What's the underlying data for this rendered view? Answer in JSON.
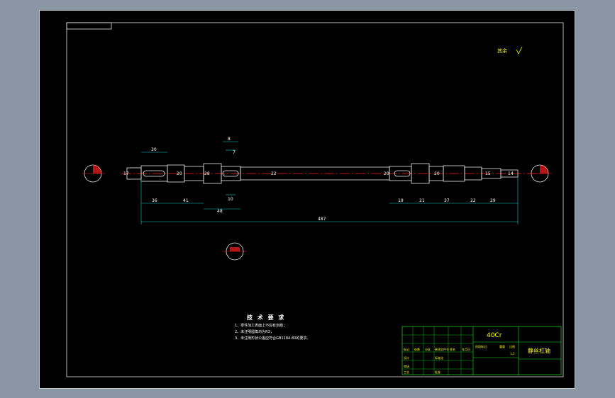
{
  "material": "40Cr",
  "part_name": "静丝杠轴",
  "tech_title": "技 术 要 求",
  "tech_notes": [
    "1、零件加工表面上不应有划痕；",
    "2、未注明圆角均为R3；",
    "3、未注明形状公差应符合GB1184-80的要求。"
  ],
  "roughness_note": "其余",
  "overall_length": "487",
  "dims_top": [
    "30",
    "8",
    "7"
  ],
  "dims_bottom": [
    "36",
    "41",
    "48",
    "10",
    "19",
    "21",
    "37",
    "22",
    "29"
  ],
  "dims_diam": [
    "17",
    "20",
    "28",
    "22",
    "20",
    "20",
    "15",
    "14"
  ],
  "title_block": {
    "labels": [
      "标记",
      "处数",
      "分区",
      "更改文件号",
      "签名",
      "年月日",
      "设计",
      "标准化",
      "审核",
      "工艺",
      "批准",
      "阶段标记",
      "重量",
      "比例"
    ],
    "scale": "1:1"
  },
  "colors": {
    "background": "#000000",
    "frame": "#ffffff",
    "dimension": "#00c8c8",
    "centerline": "#ff2020",
    "text": "#ffff00"
  }
}
